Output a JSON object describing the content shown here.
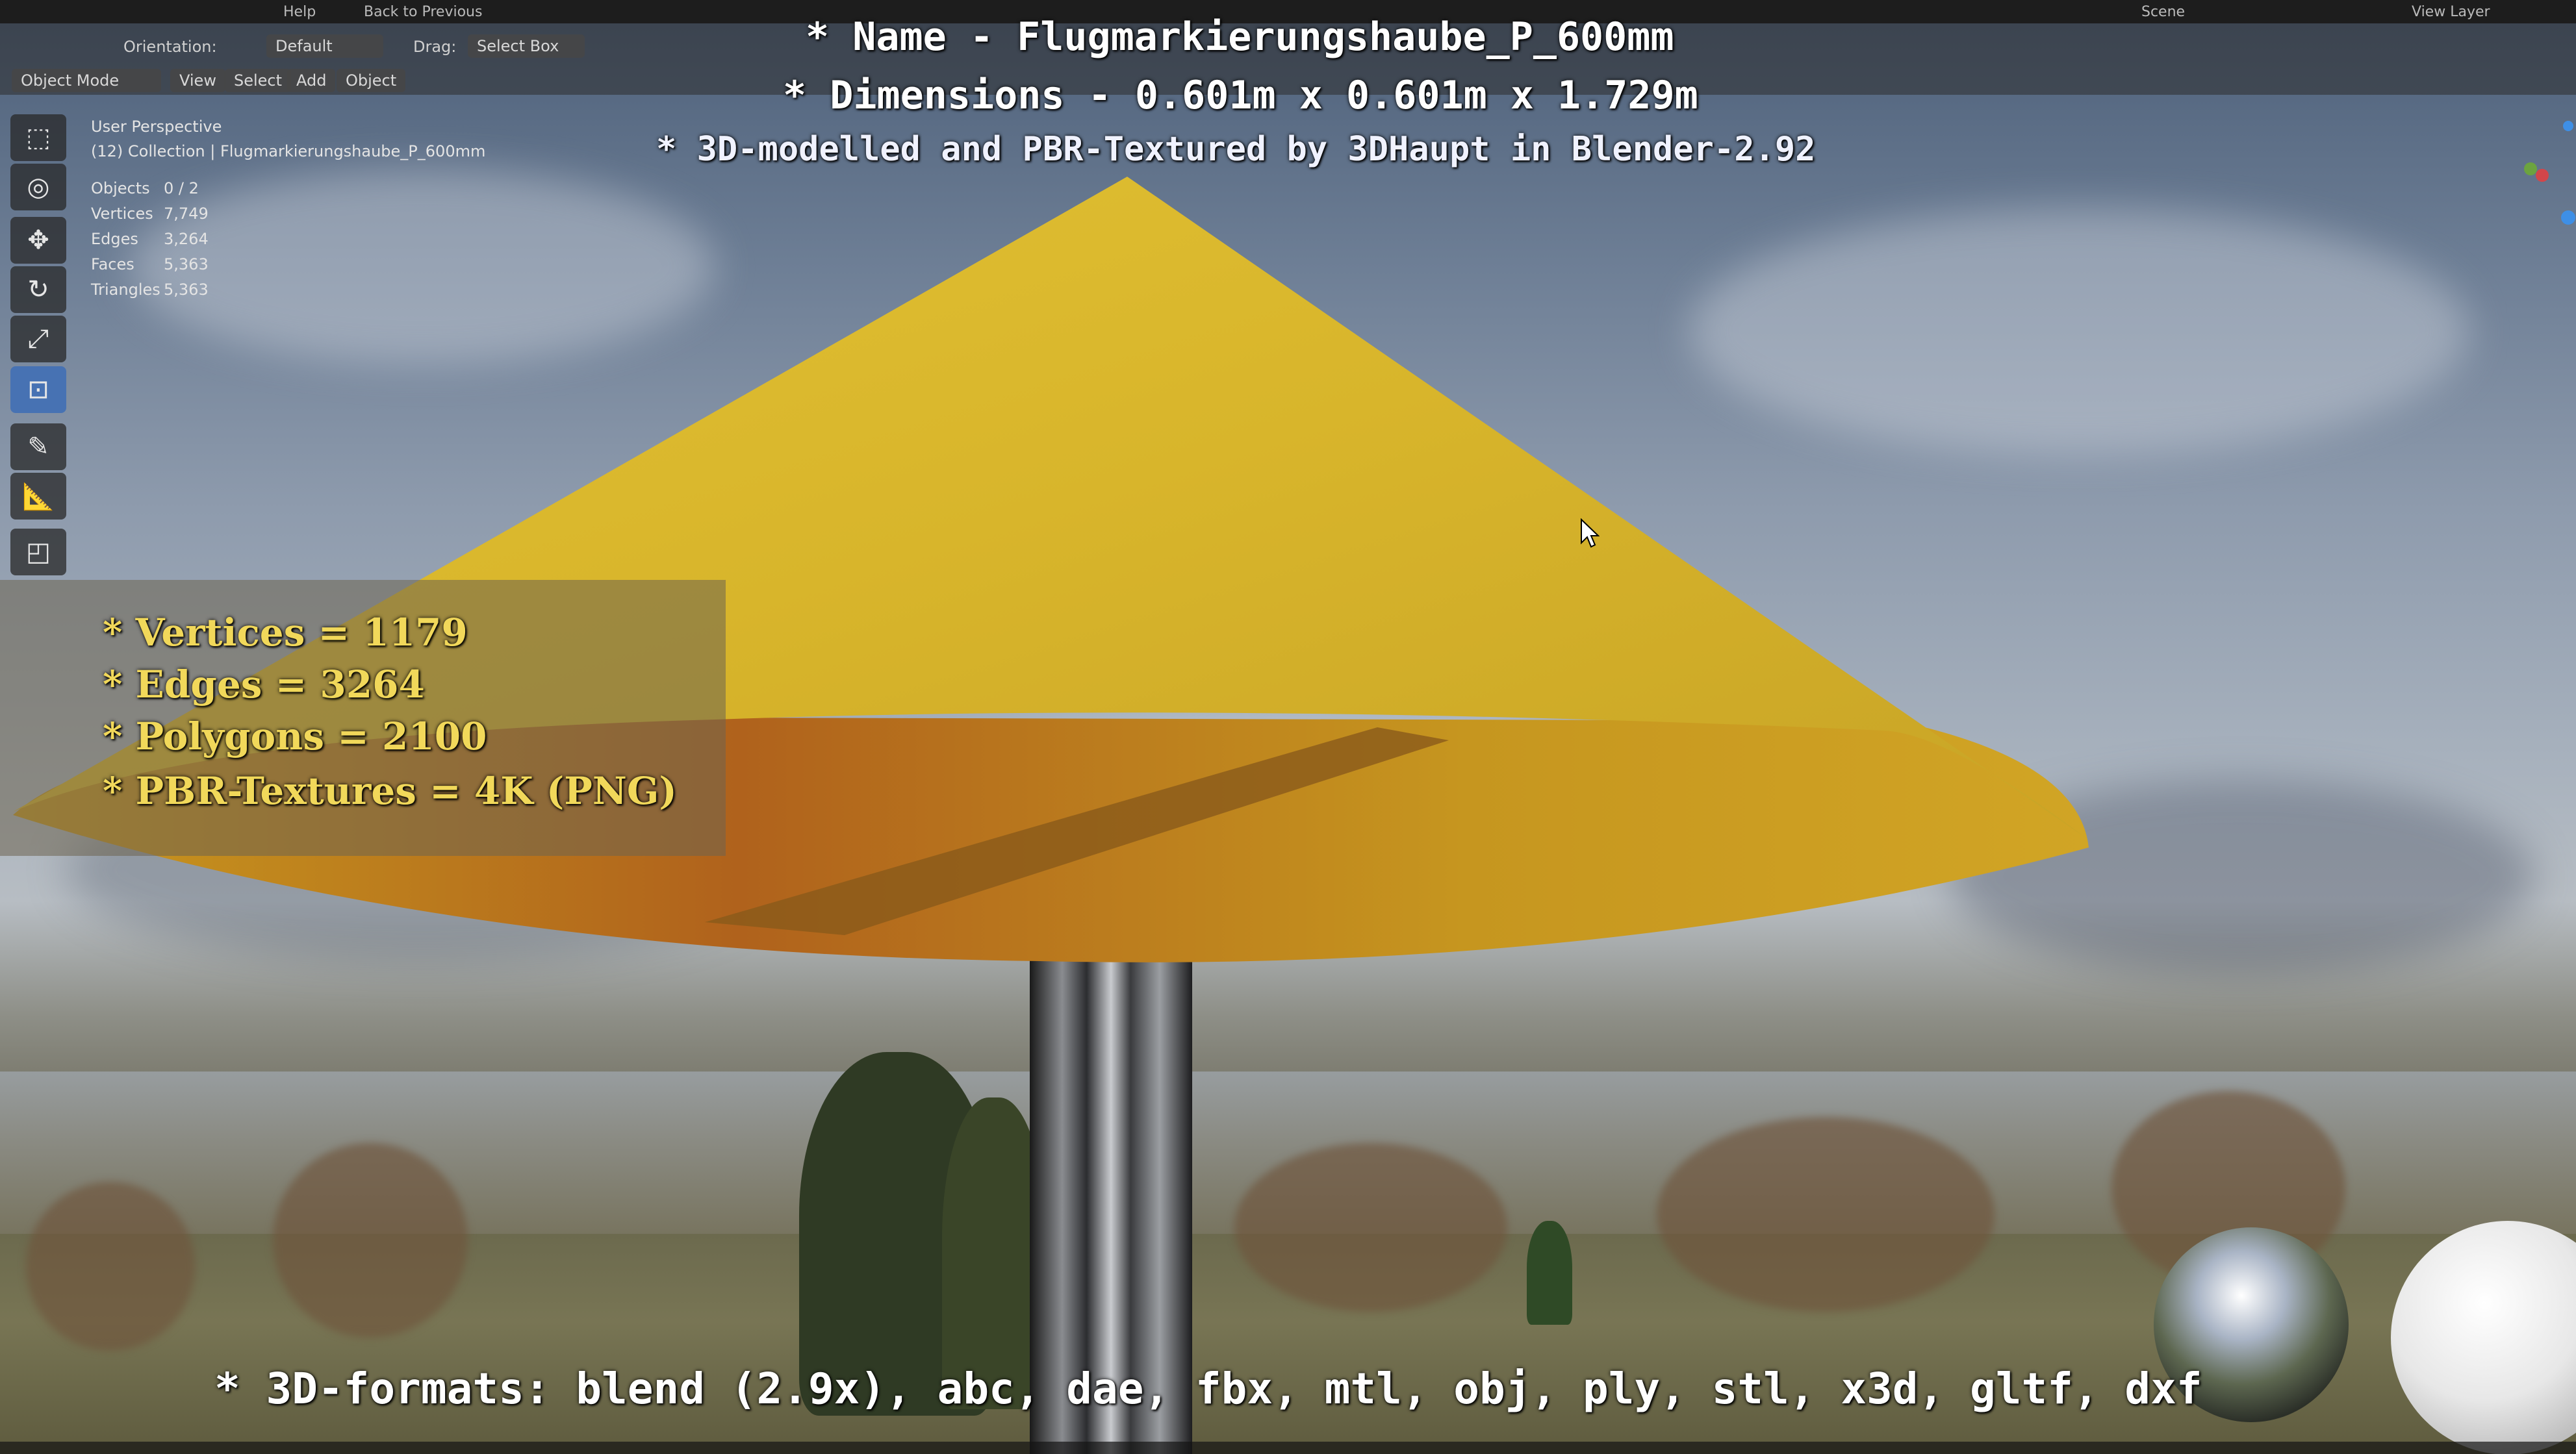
{
  "topbar": {
    "menu_help": "Help",
    "back_button": "Back to Previous",
    "scene_label": "Scene",
    "view_layer_label": "View Layer"
  },
  "header": {
    "mode_dropdown": "Object Mode",
    "menu_view": "View",
    "menu_select": "Select",
    "menu_add": "Add",
    "menu_object": "Object",
    "orientation_label": "Orientation:",
    "orientation_value": "Default",
    "drag_label": "Drag:",
    "drag_value": "Select Box"
  },
  "viewport": {
    "perspective": "User Perspective",
    "collection": "(12) Collection | Flugmarkierungshaube_P_600mm",
    "stats": [
      {
        "label": "Objects",
        "value": "0 / 2"
      },
      {
        "label": "Vertices",
        "value": "7,749"
      },
      {
        "label": "Edges",
        "value": "3,264"
      },
      {
        "label": "Faces",
        "value": "5,363"
      },
      {
        "label": "Triangles",
        "value": "5,363"
      }
    ]
  },
  "overlay": {
    "name_line": "* Name - Flugmarkierungshaube_P_600mm",
    "dimensions_line": "* Dimensions -  0.601m x 0.601m x 1.729m",
    "credit_line": "* 3D-modelled and PBR-Textured by 3DHaupt in Blender-2.92",
    "vertices_line": "* Vertices = 1179",
    "edges_line": "* Edges = 3264",
    "polygons_line": "* Polygons = 2100",
    "textures_line": "* PBR-Textures = 4K (PNG)",
    "formats_line": "* 3D-formats: blend (2.9x), abc, dae, fbx, mtl, obj, ply, stl, x3d, gltf, dxf"
  },
  "icons": {
    "tools": [
      "select-box-icon",
      "cursor-icon",
      "move-icon",
      "rotate-icon",
      "scale-icon",
      "transform-icon",
      "annotate-icon",
      "measure-icon",
      "add-cube-icon"
    ]
  },
  "colors": {
    "cone_yellow": "#d9b629",
    "active_tool": "#4772b3",
    "stats_text": "#f1d85a"
  }
}
